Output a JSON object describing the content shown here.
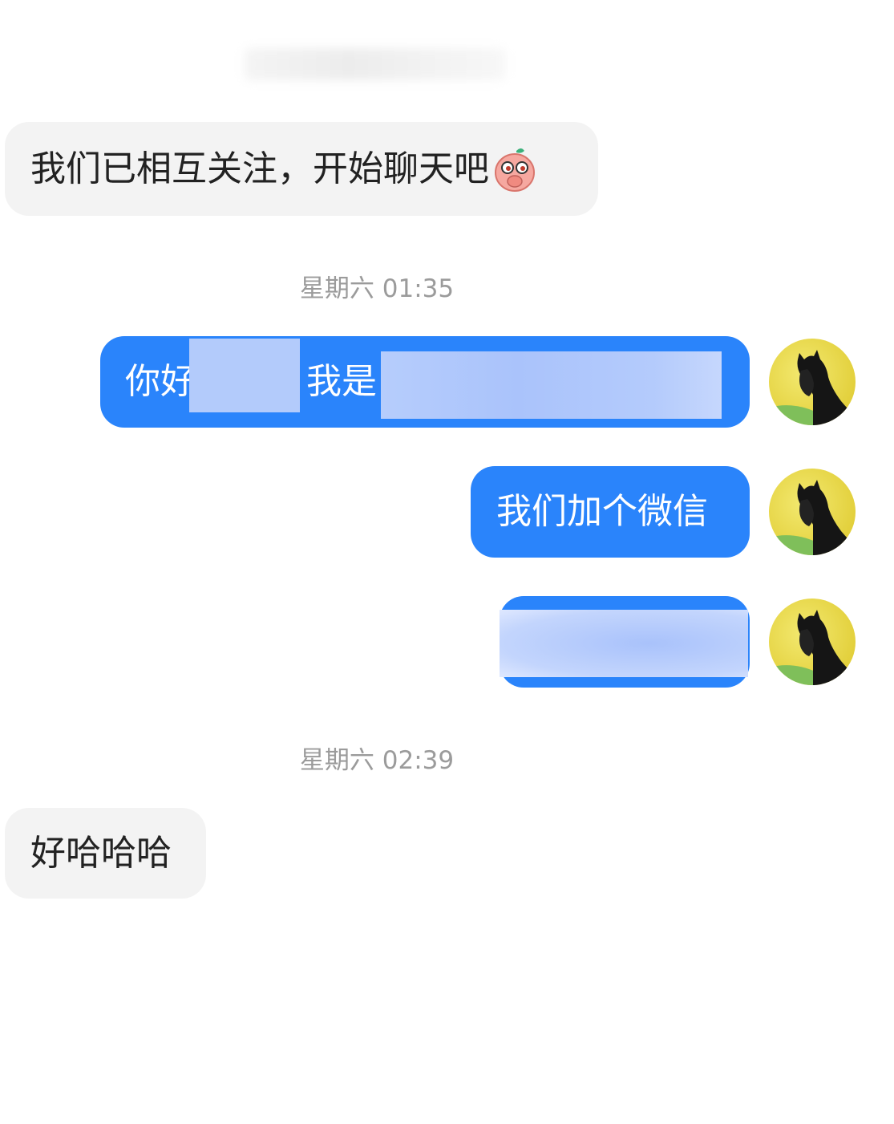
{
  "header": {
    "title_redacted": true
  },
  "messages": [
    {
      "side": "in",
      "text": "我们已相互关注，开始聊天吧",
      "emoji": "peach-face-emoji"
    },
    {
      "type": "timestamp",
      "text": "星期六 01:35"
    },
    {
      "side": "out",
      "part1": "你好",
      "part2": "我是"
    },
    {
      "side": "out",
      "text": "我们加个微信"
    },
    {
      "side": "out",
      "redacted": true
    },
    {
      "type": "timestamp",
      "text": "星期六 02:39"
    },
    {
      "side": "in",
      "text": "好哈哈哈"
    }
  ],
  "colors": {
    "outgoing_bubble": "#2a84fb",
    "incoming_bubble": "#f3f3f3",
    "timestamp": "#9b9b9b"
  },
  "avatar": {
    "icon": "black-horse-avatar-icon"
  }
}
